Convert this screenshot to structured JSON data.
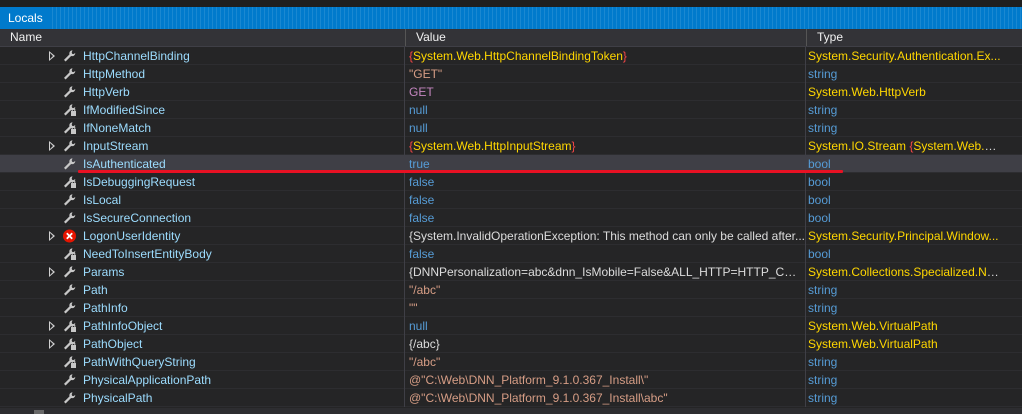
{
  "window": {
    "title": "Locals"
  },
  "columns": {
    "name": "Name",
    "value": "Value",
    "type": "Type"
  },
  "colors": {
    "accent": "#007acc",
    "highlight_line": "#e81123",
    "error_icon": "#e51400"
  },
  "rows": [
    {
      "name": "HttpChannelBinding",
      "expandable": true,
      "icon": "wrench-icon",
      "value": [
        [
          "brace-red",
          "{"
        ],
        [
          "v-yel",
          "System.Web.HttpChannelBindingToken"
        ],
        [
          "brace-red",
          "}"
        ]
      ],
      "type": [
        [
          "t-yel",
          "System.Security.Authentication.Ex..."
        ]
      ]
    },
    {
      "name": "HttpMethod",
      "expandable": false,
      "icon": "wrench-icon",
      "value": [
        [
          "v-str",
          "\"GET\""
        ]
      ],
      "type": [
        [
          "t-kw",
          "string"
        ]
      ]
    },
    {
      "name": "HttpVerb",
      "expandable": false,
      "icon": "wrench-icon",
      "value": [
        [
          "v-magenta",
          "GET"
        ]
      ],
      "type": [
        [
          "t-yel",
          "System.Web.HttpVerb"
        ]
      ]
    },
    {
      "name": "IfModifiedSince",
      "expandable": false,
      "icon": "wrench-lock-icon",
      "value": [
        [
          "v-kw",
          "null"
        ]
      ],
      "type": [
        [
          "t-kw",
          "string"
        ]
      ]
    },
    {
      "name": "IfNoneMatch",
      "expandable": false,
      "icon": "wrench-lock-icon",
      "value": [
        [
          "v-kw",
          "null"
        ]
      ],
      "type": [
        [
          "t-kw",
          "string"
        ]
      ]
    },
    {
      "name": "InputStream",
      "expandable": true,
      "icon": "wrench-icon",
      "value": [
        [
          "brace-red",
          "{"
        ],
        [
          "v-yel",
          "System.Web.HttpInputStream"
        ],
        [
          "brace-red",
          "}"
        ]
      ],
      "type": [
        [
          "t-yel",
          "System.IO.Stream "
        ],
        [
          "brace-red",
          "{"
        ],
        [
          "t-yel",
          "System.Web.Htt..."
        ]
      ]
    },
    {
      "name": "IsAuthenticated",
      "expandable": false,
      "icon": "wrench-icon",
      "selected": true,
      "value": [
        [
          "v-kw",
          "true"
        ]
      ],
      "type": [
        [
          "t-kw",
          "bool"
        ]
      ]
    },
    {
      "name": "IsDebuggingRequest",
      "expandable": false,
      "icon": "wrench-lock-icon",
      "value": [
        [
          "v-kw",
          "false"
        ]
      ],
      "type": [
        [
          "t-kw",
          "bool"
        ]
      ]
    },
    {
      "name": "IsLocal",
      "expandable": false,
      "icon": "wrench-icon",
      "value": [
        [
          "v-kw",
          "false"
        ]
      ],
      "type": [
        [
          "t-kw",
          "bool"
        ]
      ]
    },
    {
      "name": "IsSecureConnection",
      "expandable": false,
      "icon": "wrench-icon",
      "value": [
        [
          "v-kw",
          "false"
        ]
      ],
      "type": [
        [
          "t-kw",
          "bool"
        ]
      ]
    },
    {
      "name": "LogonUserIdentity",
      "expandable": true,
      "icon": "error-icon",
      "value": [
        [
          "v-gray",
          "{System.InvalidOperationException: This method can only be called after..."
        ]
      ],
      "type": [
        [
          "t-yel",
          "System.Security.Principal.Window..."
        ]
      ]
    },
    {
      "name": "NeedToInsertEntityBody",
      "expandable": false,
      "icon": "wrench-lock-icon",
      "value": [
        [
          "v-kw",
          "false"
        ]
      ],
      "type": [
        [
          "t-kw",
          "bool"
        ]
      ]
    },
    {
      "name": "Params",
      "expandable": true,
      "icon": "wrench-icon",
      "value": [
        [
          "v-gray",
          "{DNNPersonalization=abc&dnn_IsMobile=False&ALL_HTTP=HTTP_CON..."
        ]
      ],
      "type": [
        [
          "t-yel",
          "System.Collections.Specialized.Na..."
        ]
      ]
    },
    {
      "name": "Path",
      "expandable": false,
      "icon": "wrench-icon",
      "value": [
        [
          "v-str",
          "\"/abc\""
        ]
      ],
      "type": [
        [
          "t-kw",
          "string"
        ]
      ]
    },
    {
      "name": "PathInfo",
      "expandable": false,
      "icon": "wrench-icon",
      "value": [
        [
          "v-str",
          "\"\""
        ]
      ],
      "type": [
        [
          "t-kw",
          "string"
        ]
      ]
    },
    {
      "name": "PathInfoObject",
      "expandable": true,
      "icon": "wrench-lock-icon",
      "value": [
        [
          "v-kw",
          "null"
        ]
      ],
      "type": [
        [
          "t-yel",
          "System.Web.VirtualPath"
        ]
      ]
    },
    {
      "name": "PathObject",
      "expandable": true,
      "icon": "wrench-lock-icon",
      "value": [
        [
          "v-gray",
          "{/abc}"
        ]
      ],
      "type": [
        [
          "t-yel",
          "System.Web.VirtualPath"
        ]
      ]
    },
    {
      "name": "PathWithQueryString",
      "expandable": false,
      "icon": "wrench-lock-icon",
      "value": [
        [
          "v-str",
          "\"/abc\""
        ]
      ],
      "type": [
        [
          "t-kw",
          "string"
        ]
      ]
    },
    {
      "name": "PhysicalApplicationPath",
      "expandable": false,
      "icon": "wrench-icon",
      "value": [
        [
          "v-str",
          "@\"C:\\Web\\DNN_Platform_9.1.0.367_Install\\\""
        ]
      ],
      "type": [
        [
          "t-kw",
          "string"
        ]
      ]
    },
    {
      "name": "PhysicalPath",
      "expandable": false,
      "icon": "wrench-icon",
      "value": [
        [
          "v-str",
          "@\"C:\\Web\\DNN_Platform_9.1.0.367_Install\\abc\""
        ]
      ],
      "type": [
        [
          "t-kw",
          "string"
        ]
      ]
    }
  ]
}
